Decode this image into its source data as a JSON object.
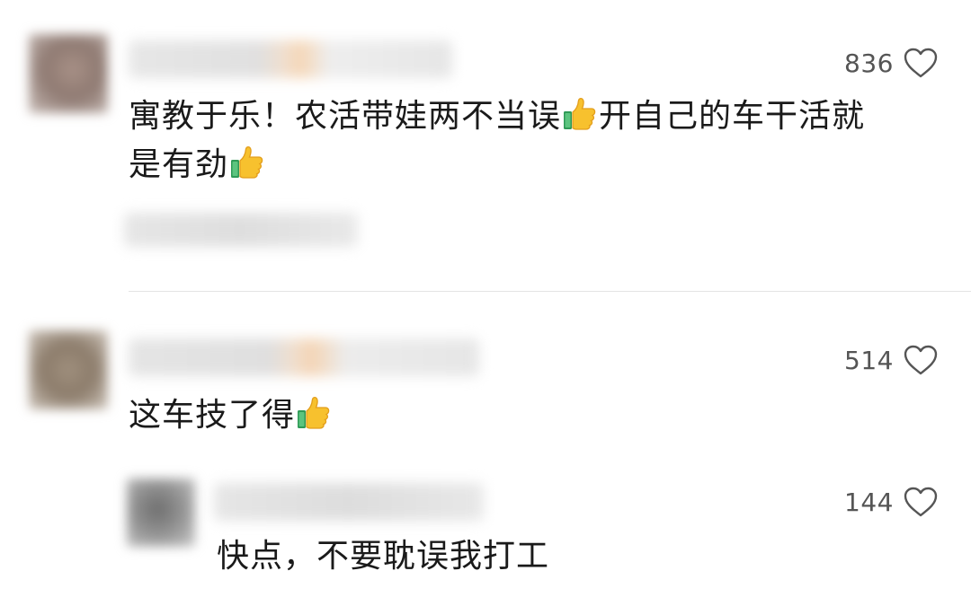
{
  "comments": [
    {
      "likes": "836",
      "text_a": "寓教于乐！农活带娃两不当误",
      "text_b": "开自己的车干活就",
      "text_c": "是有劲",
      "icon_like": "heart-outline-icon",
      "emoji": "thumbs-up-icon"
    },
    {
      "likes": "514",
      "text_a": "这车技了得",
      "icon_like": "heart-outline-icon",
      "emoji": "thumbs-up-icon",
      "replies": [
        {
          "likes": "144",
          "text_a": "快点，不要耽误我打工",
          "icon_like": "heart-outline-icon"
        }
      ]
    }
  ],
  "colors": {
    "text": "#1a1a1a",
    "count": "#555555",
    "divider": "#e4e4e4",
    "blur": "#e3e3e3"
  }
}
